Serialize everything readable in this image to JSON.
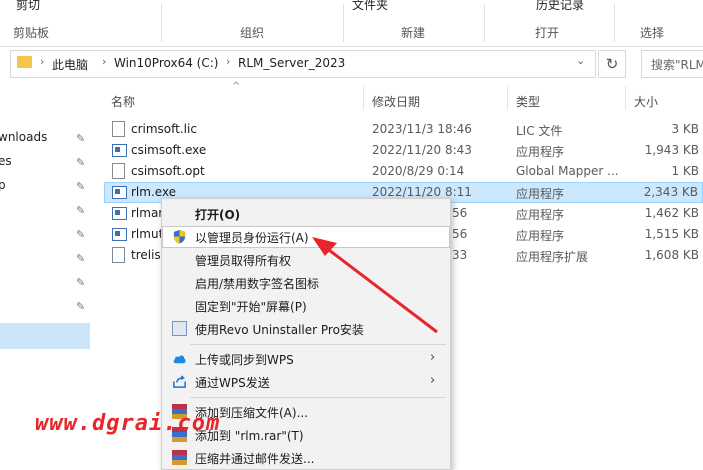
{
  "ribbon": {
    "top_items": [
      "剪切",
      "文件夹",
      "历史记录"
    ],
    "groups": [
      "剪贴板",
      "组织",
      "新建",
      "打开",
      "选择"
    ]
  },
  "address": {
    "crumbs": [
      "此电脑",
      "Win10Prox64 (C:)",
      "RLM_Server_2023"
    ],
    "search_placeholder": "搜索\"RLM"
  },
  "nav": {
    "items": [
      "wnloads",
      "es",
      "p"
    ]
  },
  "columns": {
    "name": "名称",
    "date": "修改日期",
    "type": "类型",
    "size": "大小"
  },
  "files": [
    {
      "name": "crimsoft.lic",
      "date": "2023/11/3 18:46",
      "type": "LIC 文件",
      "size": "3 KB",
      "icon": "doc-icon"
    },
    {
      "name": "csimsoft.exe",
      "date": "2022/11/20 8:43",
      "type": "应用程序",
      "size": "1,943 KB",
      "icon": "exe-icon"
    },
    {
      "name": "csimsoft.opt",
      "date": "2020/8/29 0:14",
      "type": "Global Mapper ...",
      "size": "1 KB",
      "icon": "doc-icon"
    },
    {
      "name": "rlm.exe",
      "date": "2022/11/20 8:11",
      "type": "应用程序",
      "size": "2,343 KB",
      "icon": "exe-icon"
    },
    {
      "name": "rlmar",
      "date": "56",
      "type": "应用程序",
      "size": "1,462 KB",
      "icon": "exe-icon"
    },
    {
      "name": "rlmut",
      "date": "56",
      "type": "应用程序",
      "size": "1,515 KB",
      "icon": "exe-icon"
    },
    {
      "name": "trelis",
      "date": "33",
      "type": "应用程序扩展",
      "size": "1,608 KB",
      "icon": "dll-icon"
    }
  ],
  "menu": {
    "open": "打开(O)",
    "run_as_admin": "以管理员身份运行(A)",
    "take_ownership": "管理员取得所有权",
    "signature": "启用/禁用数字签名图标",
    "pin_start": "固定到\"开始\"屏幕(P)",
    "revo": "使用Revo Uninstaller Pro安装",
    "wps_upload": "上传或同步到WPS",
    "wps_send": "通过WPS发送",
    "add_archive": "添加到压缩文件(A)...",
    "add_rlm_rar": "添加到 \"rlm.rar\"(T)",
    "compress_email": "压缩并通过邮件发送..."
  },
  "watermark": "www.dgrai.com",
  "colors": {
    "selection": "#cce8ff",
    "arrow": "#e8262a",
    "watermark": "#e8262a"
  }
}
